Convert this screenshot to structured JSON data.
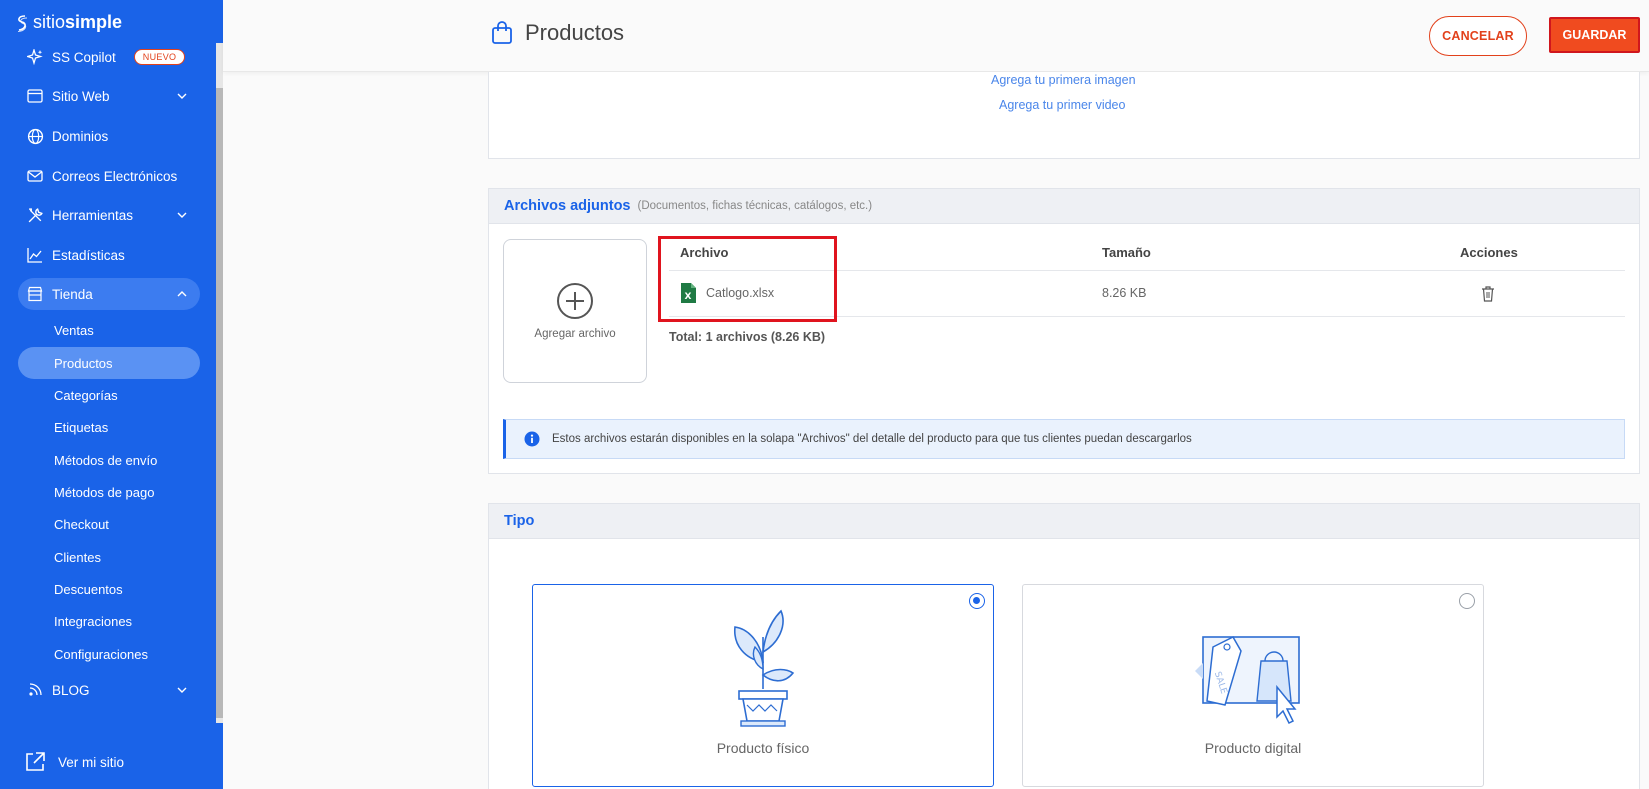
{
  "brand": {
    "logo_thin": "sitio",
    "logo_bold": "simple"
  },
  "sidebar": {
    "items": [
      {
        "label": "SS Copilot",
        "badge": "NUEVO",
        "icon": "sparkle-icon"
      },
      {
        "label": "Sitio Web",
        "icon": "browser-icon"
      },
      {
        "label": "Dominios",
        "icon": "globe-icon"
      },
      {
        "label": "Correos Electrónicos",
        "icon": "mail-icon"
      },
      {
        "label": "Herramientas",
        "icon": "tools-icon"
      },
      {
        "label": "Estadísticas",
        "icon": "chart-icon"
      },
      {
        "label": "Tienda",
        "icon": "store-icon"
      },
      {
        "label": "BLOG",
        "icon": "blog-icon"
      }
    ],
    "store_sub": [
      "Ventas",
      "Productos",
      "Categorías",
      "Etiquetas",
      "Métodos de envío",
      "Métodos de pago",
      "Checkout",
      "Clientes",
      "Descuentos",
      "Integraciones",
      "Configuraciones"
    ],
    "view_site": "Ver mi sitio"
  },
  "header": {
    "title": "Productos",
    "cancel_label": "CANCELAR",
    "save_label": "GUARDAR"
  },
  "media": {
    "add_image": "Agrega tu primera imagen",
    "add_video": "Agrega tu primer video"
  },
  "attachments": {
    "title": "Archivos adjuntos",
    "subtitle": "(Documentos, fichas técnicas, catálogos, etc.)",
    "add_file_label": "Agregar archivo",
    "columns": [
      "Archivo",
      "Tamaño",
      "Acciones"
    ],
    "files": [
      {
        "name": "Catlogo.xlsx",
        "size": "8.26 KB"
      }
    ],
    "total": "Total: 1 archivos (8.26 KB)",
    "info": "Estos archivos estarán disponibles en la solapa \"Archivos\" del detalle del producto para que tus clientes puedan descargarlos"
  },
  "tipo": {
    "title": "Tipo",
    "options": [
      {
        "label": "Producto físico",
        "selected": true
      },
      {
        "label": "Producto digital",
        "selected": false
      }
    ]
  },
  "colors": {
    "sidebar": "#1a63e8",
    "accent": "#e2411b",
    "save": "#f04b1f"
  }
}
